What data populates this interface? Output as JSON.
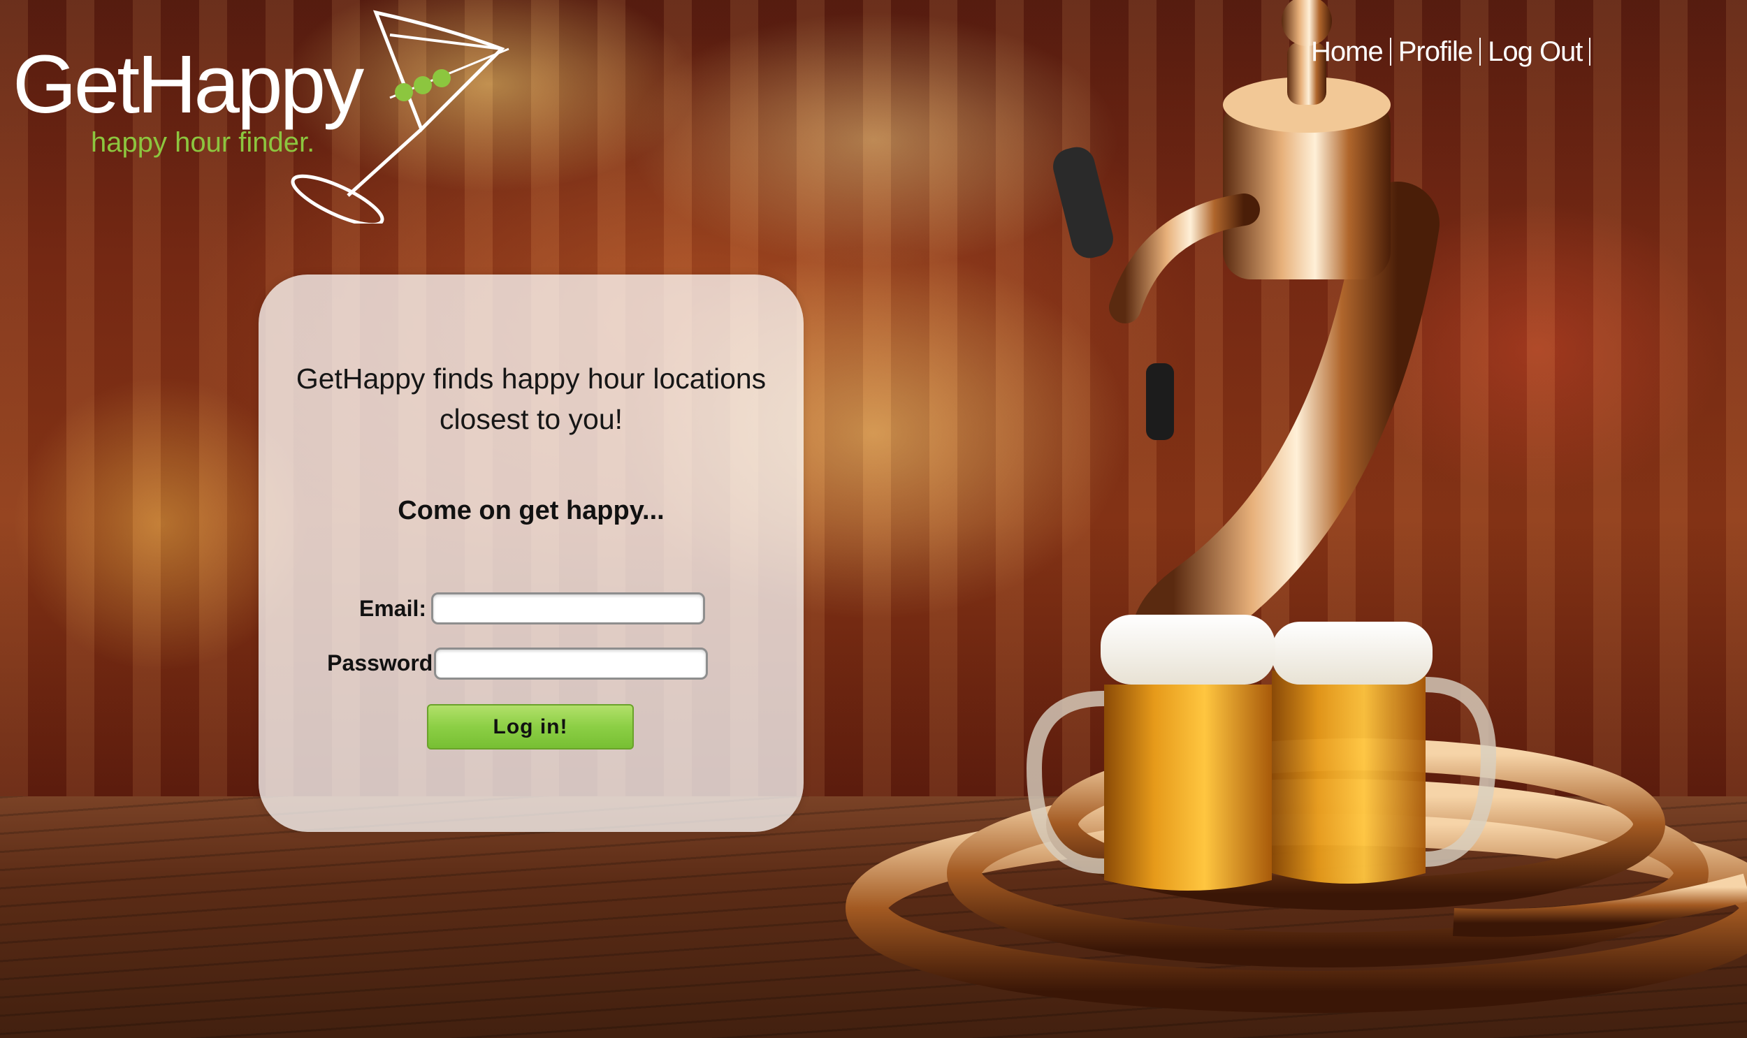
{
  "logo": {
    "title": "GetHappy",
    "tagline": "happy hour finder."
  },
  "nav": {
    "items": [
      {
        "label": "Home"
      },
      {
        "label": "Profile"
      },
      {
        "label": "Log Out"
      }
    ]
  },
  "login": {
    "tagline_line1": "GetHappy finds happy hour locations",
    "tagline_line2": "closest to you!",
    "subhead": "Come on get happy...",
    "email_label": "Email:",
    "email_value": "",
    "password_label": "Password:",
    "password_value": "",
    "submit_label": "Log in!"
  },
  "colors": {
    "accent_green": "#8cc63f",
    "button_green": "#8ccf45",
    "nav_text": "#ffffff"
  }
}
